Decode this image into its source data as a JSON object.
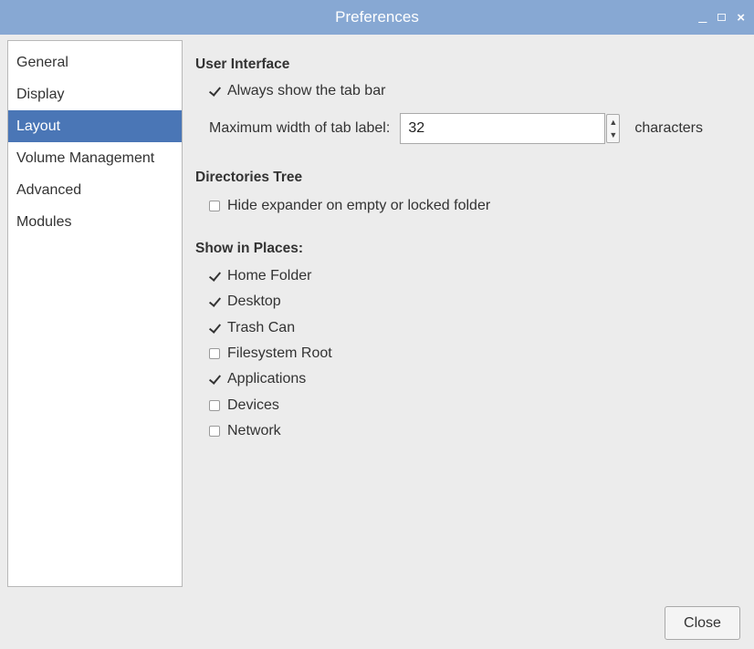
{
  "window": {
    "title": "Preferences",
    "controls": {
      "minimize": "_",
      "close": "×"
    }
  },
  "sidebar": {
    "items": [
      {
        "label": "General",
        "selected": false
      },
      {
        "label": "Display",
        "selected": false
      },
      {
        "label": "Layout",
        "selected": true
      },
      {
        "label": "Volume Management",
        "selected": false
      },
      {
        "label": "Advanced",
        "selected": false
      },
      {
        "label": "Modules",
        "selected": false
      }
    ]
  },
  "user_interface": {
    "title": "User Interface",
    "always_show_tab_bar": {
      "label": "Always show the tab bar",
      "checked": true
    },
    "max_tab_width": {
      "label": "Maximum width of tab label:",
      "value": "32",
      "suffix": "characters"
    }
  },
  "directories_tree": {
    "title": "Directories Tree",
    "hide_expander": {
      "label": "Hide expander on empty or locked folder",
      "checked": false
    }
  },
  "places": {
    "title": "Show in Places:",
    "items": [
      {
        "label": "Home Folder",
        "checked": true
      },
      {
        "label": "Desktop",
        "checked": true
      },
      {
        "label": "Trash Can",
        "checked": true
      },
      {
        "label": "Filesystem Root",
        "checked": false
      },
      {
        "label": "Applications",
        "checked": true
      },
      {
        "label": "Devices",
        "checked": false
      },
      {
        "label": "Network",
        "checked": false
      }
    ]
  },
  "footer": {
    "close_label": "Close"
  },
  "colors": {
    "titlebar": "#87a8d3",
    "selection": "#4a76b6",
    "background": "#ececec"
  }
}
